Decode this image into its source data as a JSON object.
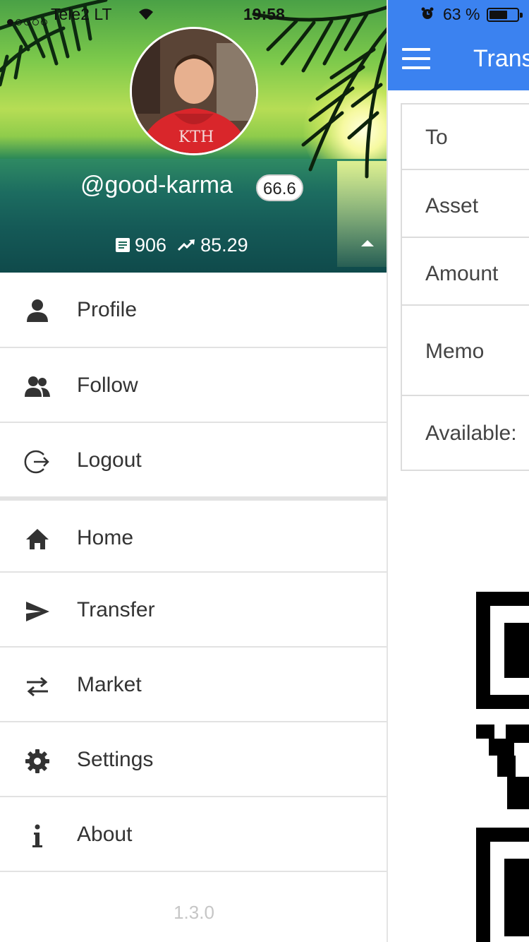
{
  "status": {
    "carrier": "Tele2 LT",
    "time": "19:58",
    "battery_text": "63 %",
    "battery_level": 0.63
  },
  "profile": {
    "username": "@good-karma",
    "reputation": "66.6",
    "posts_count": "906",
    "trend_value": "85.29"
  },
  "menu": {
    "items": [
      {
        "label": "Profile",
        "icon": "person-icon"
      },
      {
        "label": "Follow",
        "icon": "people-icon"
      },
      {
        "label": "Logout",
        "icon": "logout-icon"
      },
      {
        "label": "Home",
        "icon": "home-icon"
      },
      {
        "label": "Transfer",
        "icon": "send-icon"
      },
      {
        "label": "Market",
        "icon": "swap-arrows-icon"
      },
      {
        "label": "Settings",
        "icon": "gear-icon"
      },
      {
        "label": "About",
        "icon": "info-icon"
      }
    ]
  },
  "version": "1.3.0",
  "main": {
    "title": "Transfer",
    "form": {
      "to_label": "To",
      "asset_label": "Asset",
      "amount_label": "Amount",
      "memo_label": "Memo",
      "available_label": "Available: "
    }
  },
  "colors": {
    "header_blue": "#3b82f0",
    "divider": "#e2e2e2",
    "icon": "#333333"
  }
}
